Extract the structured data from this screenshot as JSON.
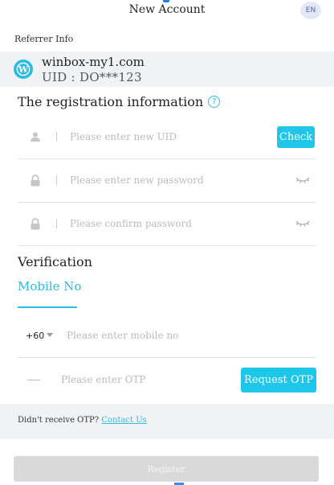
{
  "header": {
    "title": "New Account",
    "lang": "EN"
  },
  "referrer": {
    "section_label": "Referrer Info",
    "name": "winbox-my1.com",
    "uid_label": "UID :",
    "uid_value": "DO***123"
  },
  "registration": {
    "title": "The registration information",
    "help_icon": "question-circle-icon",
    "uid_placeholder": "Please enter new UID",
    "check_label": "Check",
    "password_placeholder": "Please enter new password",
    "confirm_placeholder": "Please confirm password"
  },
  "verification": {
    "title": "Verification",
    "tab_mobile": "Mobile No",
    "country_code": "+60",
    "mobile_placeholder": "Please enter mobile no",
    "otp_placeholder": "Please enter OTP",
    "request_otp_label": "Request OTP",
    "otp_help": "Didn't receive OTP?",
    "contact_link": "Contact Us"
  },
  "register_label": "Register",
  "colors": {
    "accent": "#1ec7ea",
    "link": "#2dbbe0",
    "disabled": "#d9d9d9",
    "band": "#f1f2f4"
  }
}
